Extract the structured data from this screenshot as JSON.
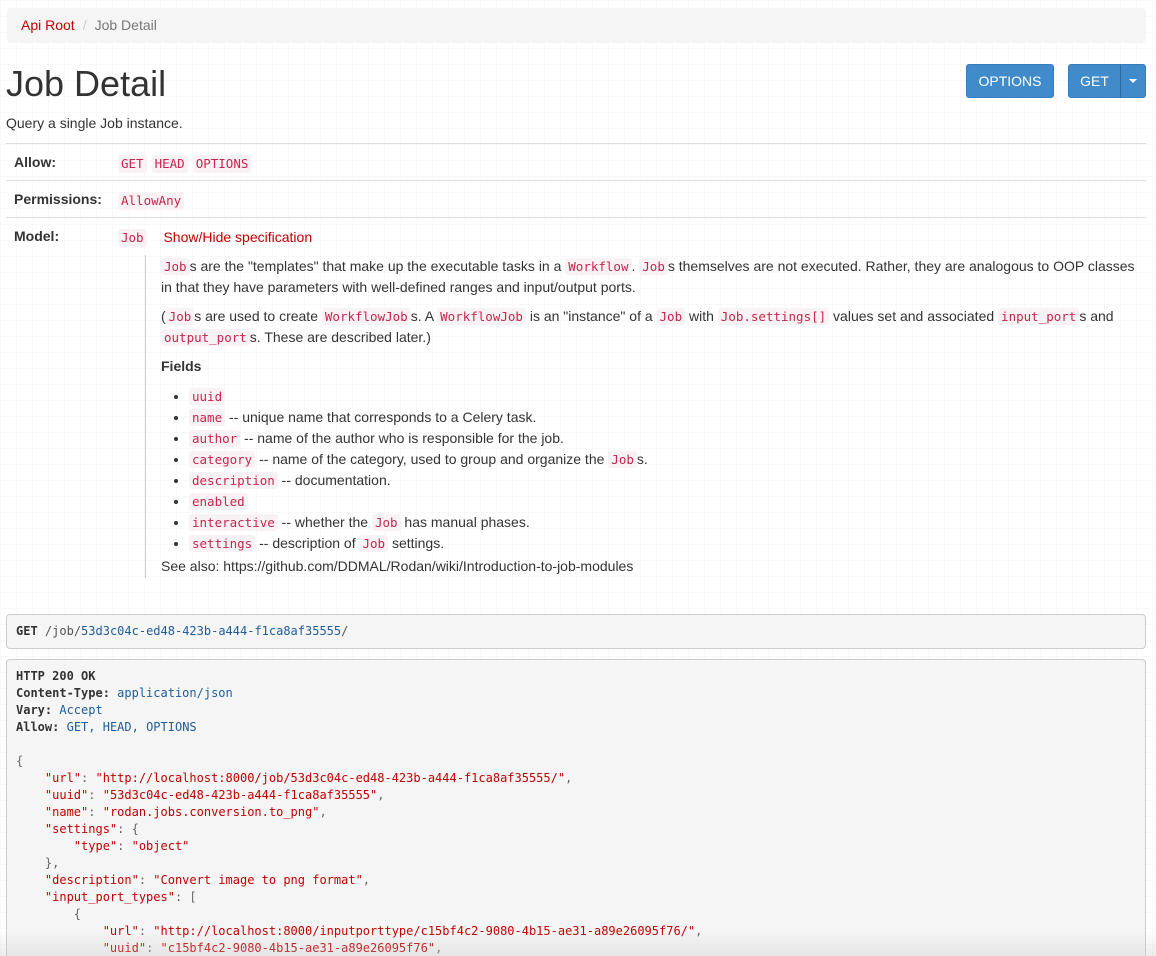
{
  "breadcrumb": {
    "root": "Api Root",
    "separator": "/",
    "current": "Job Detail"
  },
  "page": {
    "title": "Job Detail",
    "description": "Query a single Job instance."
  },
  "buttons": {
    "options": "OPTIONS",
    "get": "GET"
  },
  "meta": {
    "allow_label": "Allow:",
    "allow_methods": [
      "GET",
      "HEAD",
      "OPTIONS"
    ],
    "permissions_label": "Permissions:",
    "permissions": [
      "AllowAny"
    ],
    "model_label": "Model:",
    "model_name": "Job",
    "spec_toggle": "Show/Hide specification"
  },
  "spec": {
    "p1": {
      "c1": "Job",
      "t1": "s are the \"templates\" that make up the executable tasks in a ",
      "c2": "Workflow",
      "t2": ". ",
      "c3": "Job",
      "t3": "s themselves are not executed. Rather, they are analogous to OOP classes in that they have parameters with well-defined ranges and input/output ports."
    },
    "p2": {
      "t0": "(",
      "c1": "Job",
      "t1": "s are used to create ",
      "c2": "WorkflowJob",
      "t2": "s. A ",
      "c3": "WorkflowJob",
      "t3": " is an \"instance\" of a ",
      "c4": "Job",
      "t4": " with ",
      "c5": "Job.settings[]",
      "t5": " values set and associated ",
      "c6": "input_port",
      "t6": "s and ",
      "c7": "output_port",
      "t7": "s. These are described later.)"
    },
    "fields_heading": "Fields",
    "fields": [
      {
        "code": "uuid",
        "text": ""
      },
      {
        "code": "name",
        "text": " -- unique name that corresponds to a Celery task."
      },
      {
        "code": "author",
        "text": " -- name of the author who is responsible for the job."
      },
      {
        "code": "category",
        "text": " -- name of the category, used to group and organize the ",
        "code2": "Job",
        "text2": "s."
      },
      {
        "code": "description",
        "text": " -- documentation."
      },
      {
        "code": "enabled",
        "text": ""
      },
      {
        "code": "interactive",
        "text": " -- whether the ",
        "code2": "Job",
        "text2": " has manual phases."
      },
      {
        "code": "settings",
        "text": " -- description of ",
        "code2": "Job",
        "text2": " settings."
      }
    ],
    "see_also": "See also: https://github.com/DDMAL/Rodan/wiki/Introduction-to-job-modules"
  },
  "request": {
    "method": "GET",
    "path_prefix": "/job/",
    "uuid": "53d3c04c-ed48-423b-a444-f1ca8af35555",
    "path_suffix": "/"
  },
  "response": {
    "status": "HTTP 200 OK",
    "headers": [
      {
        "key": "Content-Type:",
        "value": "application/json"
      },
      {
        "key": "Vary:",
        "value": "Accept"
      },
      {
        "key": "Allow:",
        "value": "GET, HEAD, OPTIONS"
      }
    ],
    "body": [
      {
        "indent": "",
        "pre": "{",
        "key": "",
        "sep": "",
        "val": "",
        "post": ""
      },
      {
        "indent": "    ",
        "pre": "",
        "key": "\"url\"",
        "sep": ": ",
        "val": "\"http://localhost:8000/job/53d3c04c-ed48-423b-a444-f1ca8af35555/\"",
        "post": ","
      },
      {
        "indent": "    ",
        "pre": "",
        "key": "\"uuid\"",
        "sep": ": ",
        "val": "\"53d3c04c-ed48-423b-a444-f1ca8af35555\"",
        "post": ","
      },
      {
        "indent": "    ",
        "pre": "",
        "key": "\"name\"",
        "sep": ": ",
        "val": "\"rodan.jobs.conversion.to_png\"",
        "post": ","
      },
      {
        "indent": "    ",
        "pre": "",
        "key": "\"settings\"",
        "sep": ": ",
        "val": "",
        "post": "{"
      },
      {
        "indent": "        ",
        "pre": "",
        "key": "\"type\"",
        "sep": ": ",
        "val": "\"object\"",
        "post": ""
      },
      {
        "indent": "    ",
        "pre": "},",
        "key": "",
        "sep": "",
        "val": "",
        "post": ""
      },
      {
        "indent": "    ",
        "pre": "",
        "key": "\"description\"",
        "sep": ": ",
        "val": "\"Convert image to png format\"",
        "post": ","
      },
      {
        "indent": "    ",
        "pre": "",
        "key": "\"input_port_types\"",
        "sep": ": ",
        "val": "",
        "post": "["
      },
      {
        "indent": "        ",
        "pre": "{",
        "key": "",
        "sep": "",
        "val": "",
        "post": ""
      },
      {
        "indent": "            ",
        "pre": "",
        "key": "\"url\"",
        "sep": ": ",
        "val": "\"http://localhost:8000/inputporttype/c15bf4c2-9080-4b15-ae31-a89e26095f76/\"",
        "post": ","
      },
      {
        "indent": "            ",
        "pre": "",
        "key": "\"uuid\"",
        "sep": ": ",
        "val": "\"c15bf4c2-9080-4b15-ae31-a89e26095f76\"",
        "post": ","
      }
    ]
  },
  "colors": {
    "link": "#c20000",
    "primary_button": "#428bca",
    "code_text": "#c7254e",
    "code_bg": "#f9f2f4"
  }
}
